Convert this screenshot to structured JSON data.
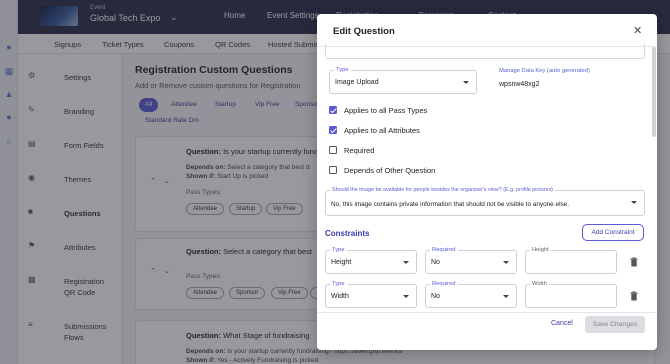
{
  "header": {
    "event_small_label": "Event",
    "event_name": "Global Tech Expo",
    "nav": [
      "Home",
      "Event Settings",
      "Registration",
      "Campaign",
      "Content"
    ]
  },
  "subnav": [
    "Signups",
    "Ticket Types",
    "Coupons",
    "QR Codes",
    "Hosted Submis"
  ],
  "sidebar": {
    "items": [
      {
        "label": "Settings"
      },
      {
        "label": "Branding"
      },
      {
        "label": "Form Fields"
      },
      {
        "label": "Themes"
      },
      {
        "label": "Questions"
      },
      {
        "label": "Attributes"
      },
      {
        "label": "Registration QR Code"
      },
      {
        "label": "Submissions Flows"
      }
    ]
  },
  "main": {
    "title": "Registration Custom Questions",
    "subtitle": "Add or Remove custom questions for Registration",
    "filters": [
      "All",
      "Attendee",
      "Startup",
      "Vip Free",
      "Sponso",
      "Standard Rate Dm"
    ],
    "cards": [
      {
        "question_label": "Question:",
        "question": "Is your startup currently fundra",
        "depends_label": "Depends on:",
        "depends": "Select a category that best d",
        "shown_label": "Shown if:",
        "shown": "Start Up is picked",
        "pass_types_label": "Pass Types:",
        "tags": [
          "Attendee",
          "Startup",
          "Vip Free"
        ]
      },
      {
        "question_label": "Question:",
        "question": "Select a category that best",
        "pass_types_label": "Pass Types:",
        "tags": [
          "Attendee",
          "Sponsor",
          "Vip Free",
          "St"
        ]
      },
      {
        "question_label": "Question:",
        "question": "What Stage of fundraising",
        "depends_label": "Depends on:",
        "depends": "Is your startup currently fundraising? https://www.grip.events/",
        "shown_label": "Shown if:",
        "shown": "Yes - Actively Fundraising is picked"
      }
    ]
  },
  "modal": {
    "title": "Edit Question",
    "type_label": "Type",
    "type_value": "Image Upload",
    "data_key_label": "Manage Data Key (auto generated)",
    "data_key_value": "wpsnw48xg2",
    "checkboxes": [
      {
        "label": "Applies to all Pass Types",
        "checked": true
      },
      {
        "label": "Applies to all Attributes",
        "checked": true
      },
      {
        "label": "Required",
        "checked": false
      },
      {
        "label": "Depends of Other Question",
        "checked": false
      }
    ],
    "visibility_label": "Should the image be available for people besides the organiser's view? (E.g. profile pictures)",
    "visibility_value": "No, this image contains private information that should not be visible to anyone else.",
    "constraints_title": "Constraints",
    "add_constraint_label": "Add Constraint",
    "constraints": [
      {
        "type_label": "Type",
        "type": "Height",
        "required_label": "Required",
        "required": "No",
        "value_label": "Height"
      },
      {
        "type_label": "Type",
        "type": "Width",
        "required_label": "Required",
        "required": "No",
        "value_label": "Width"
      }
    ],
    "cancel_label": "Cancel",
    "save_label": "Save Changes"
  },
  "colors": {
    "accent": "#5b5bd6",
    "topbar": "#2b2b4a"
  }
}
